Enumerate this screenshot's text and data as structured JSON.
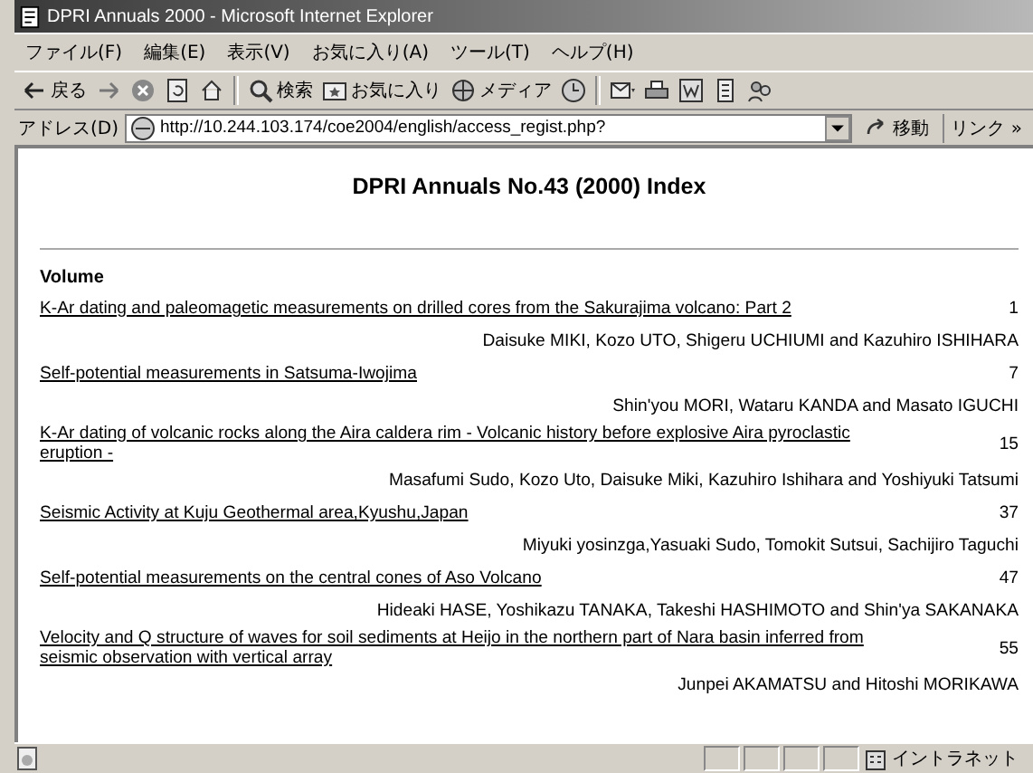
{
  "window": {
    "title": "DPRI Annuals 2000 - Microsoft Internet Explorer"
  },
  "menu": [
    "ファイル(F)",
    "編集(E)",
    "表示(V)",
    "お気に入り(A)",
    "ツール(T)",
    "ヘルプ(H)"
  ],
  "toolbar": [
    {
      "kind": "back",
      "label": "戻る"
    },
    {
      "kind": "forward"
    },
    {
      "kind": "stop"
    },
    {
      "kind": "refresh"
    },
    {
      "kind": "home"
    },
    {
      "kind": "sep"
    },
    {
      "kind": "search",
      "label": "検索"
    },
    {
      "kind": "favorites",
      "label": "お気に入り"
    },
    {
      "kind": "media",
      "label": "メディア"
    },
    {
      "kind": "history"
    },
    {
      "kind": "sep"
    },
    {
      "kind": "mail"
    },
    {
      "kind": "print"
    },
    {
      "kind": "edit"
    },
    {
      "kind": "discuss"
    },
    {
      "kind": "messenger"
    }
  ],
  "address": {
    "label": "アドレス(D)",
    "url": "http://10.244.103.174/coe2004/english/access_regist.php?",
    "go": "移動",
    "links": "リンク »"
  },
  "page": {
    "title": "DPRI Annuals No.43 (2000) Index",
    "section": "Volume",
    "articles": [
      {
        "title": "K-Ar dating and paleomagetic measurements on drilled cores from the Sakurajima volcano: Part 2",
        "page": "1",
        "authors": "Daisuke MIKI, Kozo UTO, Shigeru UCHIUMI and Kazuhiro ISHIHARA"
      },
      {
        "title": "Self-potential measurements in Satsuma-Iwojima",
        "page": "7",
        "authors": "Shin'you MORI, Wataru KANDA and Masato IGUCHI"
      },
      {
        "title": "K-Ar dating of volcanic rocks along the Aira caldera rim - Volcanic history before explosive Aira pyroclastic eruption -",
        "page": "15",
        "authors": "Masafumi Sudo, Kozo Uto, Daisuke Miki, Kazuhiro Ishihara and Yoshiyuki Tatsumi"
      },
      {
        "title": "Seismic Activity at Kuju Geothermal area,Kyushu,Japan",
        "page": "37",
        "authors": "Miyuki yosinzga,Yasuaki Sudo, Tomokit Sutsui, Sachijiro Taguchi"
      },
      {
        "title": "Self-potential measurements on the central cones of Aso Volcano",
        "page": "47",
        "authors": "Hideaki HASE, Yoshikazu TANAKA, Takeshi HASHIMOTO and Shin'ya SAKANAKA"
      },
      {
        "title": "Velocity and Q structure of waves for soil sediments at Heijo in the northern part of Nara basin inferred from seismic observation with vertical array",
        "page": "55",
        "authors": "Junpei AKAMATSU and Hitoshi MORIKAWA"
      }
    ]
  },
  "status": {
    "zone": "イントラネット"
  }
}
